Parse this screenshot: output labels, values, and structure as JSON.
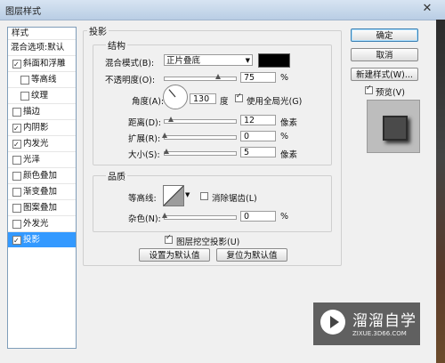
{
  "window": {
    "title": "图层样式",
    "close_label": "✕"
  },
  "left_panel": {
    "header": "样式",
    "items": [
      {
        "label": "混合选项:默认",
        "checkbox": false,
        "checked": false
      },
      {
        "label": "斜面和浮雕",
        "checkbox": true,
        "checked": true
      },
      {
        "label": "等高线",
        "checkbox": true,
        "checked": false,
        "indent": true
      },
      {
        "label": "纹理",
        "checkbox": true,
        "checked": false,
        "indent": true
      },
      {
        "label": "描边",
        "checkbox": true,
        "checked": false
      },
      {
        "label": "内阴影",
        "checkbox": true,
        "checked": true
      },
      {
        "label": "内发光",
        "checkbox": true,
        "checked": true
      },
      {
        "label": "光泽",
        "checkbox": true,
        "checked": false
      },
      {
        "label": "颜色叠加",
        "checkbox": true,
        "checked": false
      },
      {
        "label": "渐变叠加",
        "checkbox": true,
        "checked": false
      },
      {
        "label": "图案叠加",
        "checkbox": true,
        "checked": false
      },
      {
        "label": "外发光",
        "checkbox": true,
        "checked": false
      },
      {
        "label": "投影",
        "checkbox": true,
        "checked": true,
        "active": true
      }
    ]
  },
  "drop_shadow": {
    "section_title": "投影",
    "structure": {
      "title": "结构",
      "blend_mode_label": "混合模式(B):",
      "blend_mode_value": "正片叠底",
      "color": "#000000",
      "opacity_label": "不透明度(O):",
      "opacity_value": "75",
      "opacity_unit": "%",
      "opacity_fraction": 0.75,
      "angle_label": "角度(A):",
      "angle_value": "130",
      "angle_unit": "度",
      "global_light_label": "使用全局光(G)",
      "global_light_checked": true,
      "distance_label": "距离(D):",
      "distance_value": "12",
      "distance_unit": "像素",
      "spread_label": "扩展(R):",
      "spread_value": "0",
      "spread_unit": "%",
      "size_label": "大小(S):",
      "size_value": "5",
      "size_unit": "像素"
    },
    "quality": {
      "title": "品质",
      "contour_label": "等高线:",
      "anti_alias_label": "消除锯齿(L)",
      "anti_alias_checked": false,
      "noise_label": "杂色(N):",
      "noise_value": "0",
      "noise_unit": "%"
    },
    "knockout_label": "图层挖空投影(U)",
    "knockout_checked": true,
    "make_default_label": "设置为默认值",
    "reset_default_label": "复位为默认值"
  },
  "buttons": {
    "ok": "确定",
    "cancel": "取消",
    "new_style": "新建样式(W)...",
    "preview_label": "预览(V)",
    "preview_checked": true
  },
  "watermark": {
    "brand": "溜溜自学",
    "url": "ZIXUE.3D66.COM"
  }
}
